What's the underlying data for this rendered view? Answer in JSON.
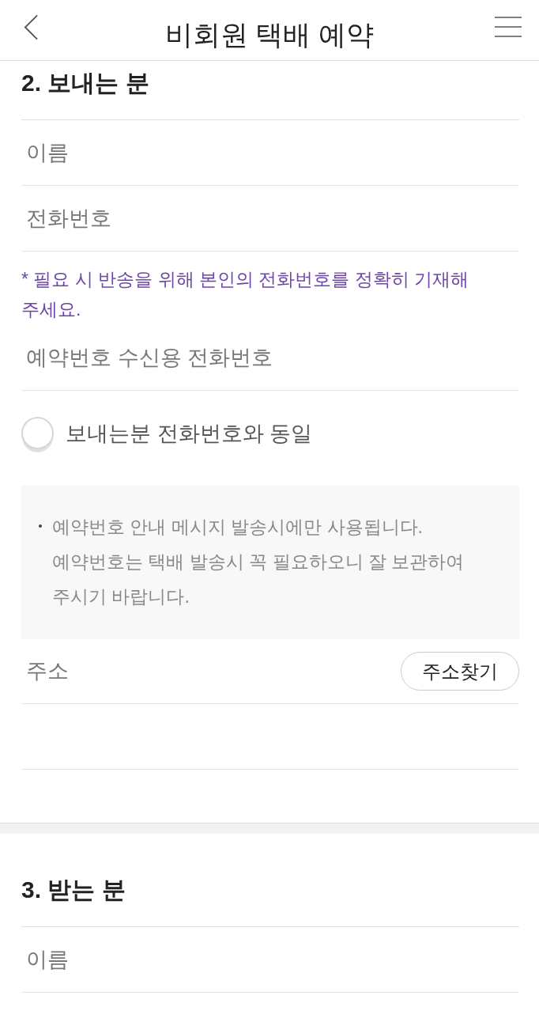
{
  "header": {
    "title": "비회원 택배 예약"
  },
  "sections": [
    {
      "heading": "2. 보내는 분",
      "items": [
        {
          "kind": "field",
          "placeholder": "이름"
        },
        {
          "kind": "field",
          "placeholder": "전화번호"
        },
        {
          "kind": "note",
          "text": "* 필요 시 반송을 위해 본인의 전화번호를 정확히 기재해 주세요."
        },
        {
          "kind": "field",
          "placeholder": "예약번호 수신용 전화번호"
        },
        {
          "kind": "checkbox",
          "label": "보내는분 전화번호와 동일",
          "checked": false
        },
        {
          "kind": "notice",
          "text": "예약번호 안내 메시지 발송시에만 사용됩니다. 예약번호는 택배 발송시 꼭 필요하오니 잘 보관하여 주시기 바랍니다."
        },
        {
          "kind": "address",
          "placeholder": "주소",
          "button": "주소찾기"
        },
        {
          "kind": "field"
        }
      ]
    },
    {
      "heading": "3. 받는 분",
      "items": [
        {
          "kind": "field",
          "placeholder": "이름"
        }
      ]
    }
  ]
}
